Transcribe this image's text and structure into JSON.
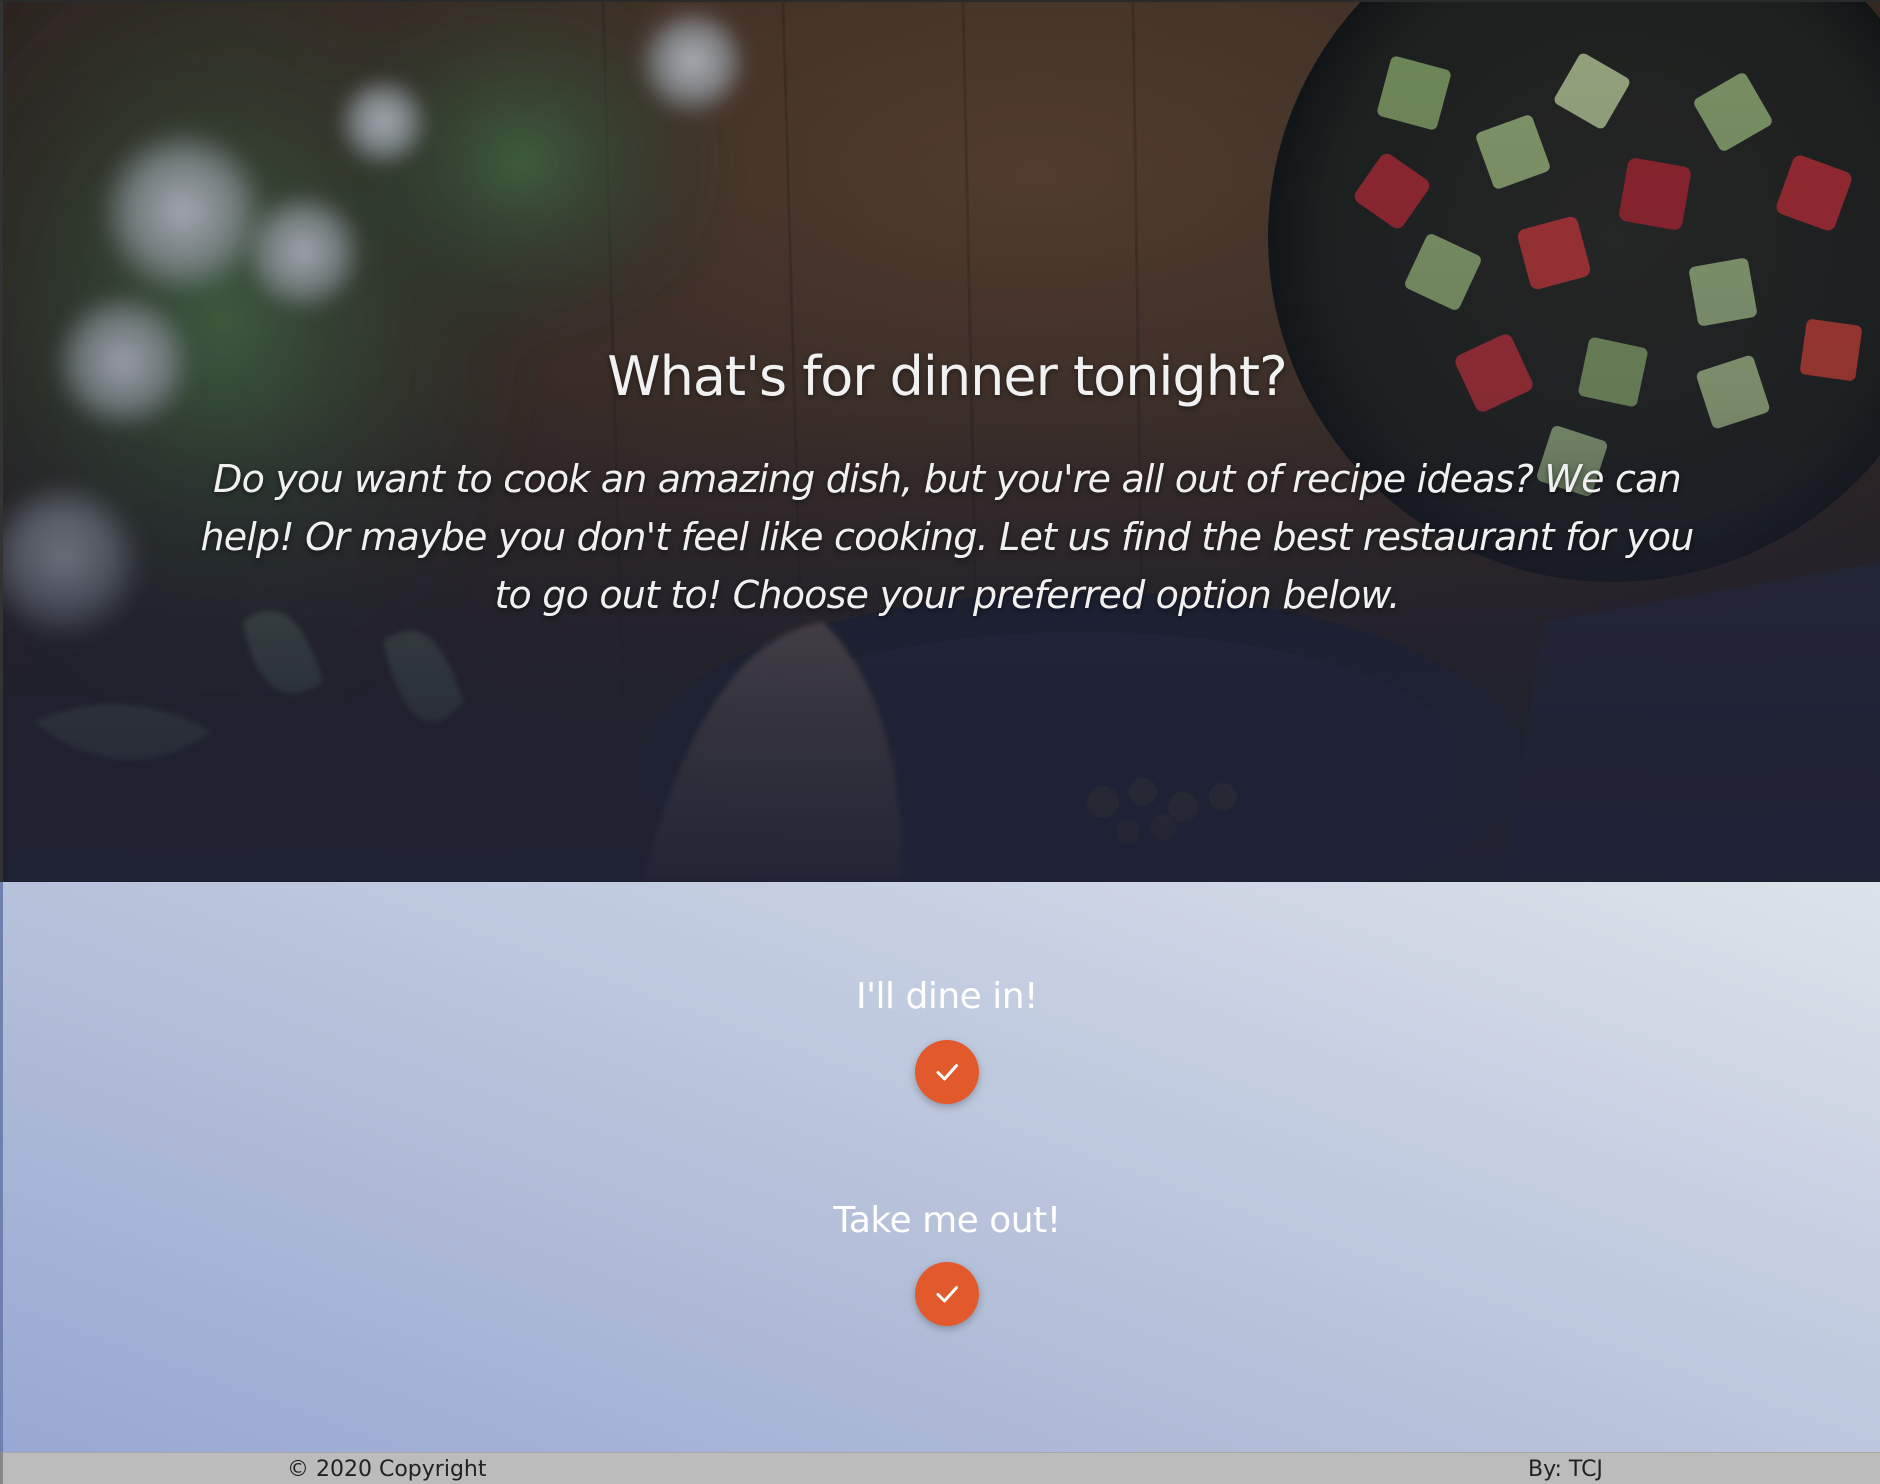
{
  "hero": {
    "title": "What's for dinner tonight?",
    "description": "Do you want to cook an amazing dish, but you're all out of recipe ideas? We can help! Or maybe you don't feel like cooking. Let us find the best restaurant for you to go out to! Choose your preferred option below."
  },
  "options": {
    "dine_in": {
      "label": "I'll dine in!",
      "icon": "checkmark-icon"
    },
    "take_out": {
      "label": "Take me out!",
      "icon": "checkmark-icon"
    }
  },
  "footer": {
    "copyright": "© 2020 Copyright",
    "author": "By: TCJ"
  },
  "colors": {
    "accent": "#e25a2b",
    "hero_overlay": "#1e2133",
    "footer_bg": "#bcbcbc"
  }
}
